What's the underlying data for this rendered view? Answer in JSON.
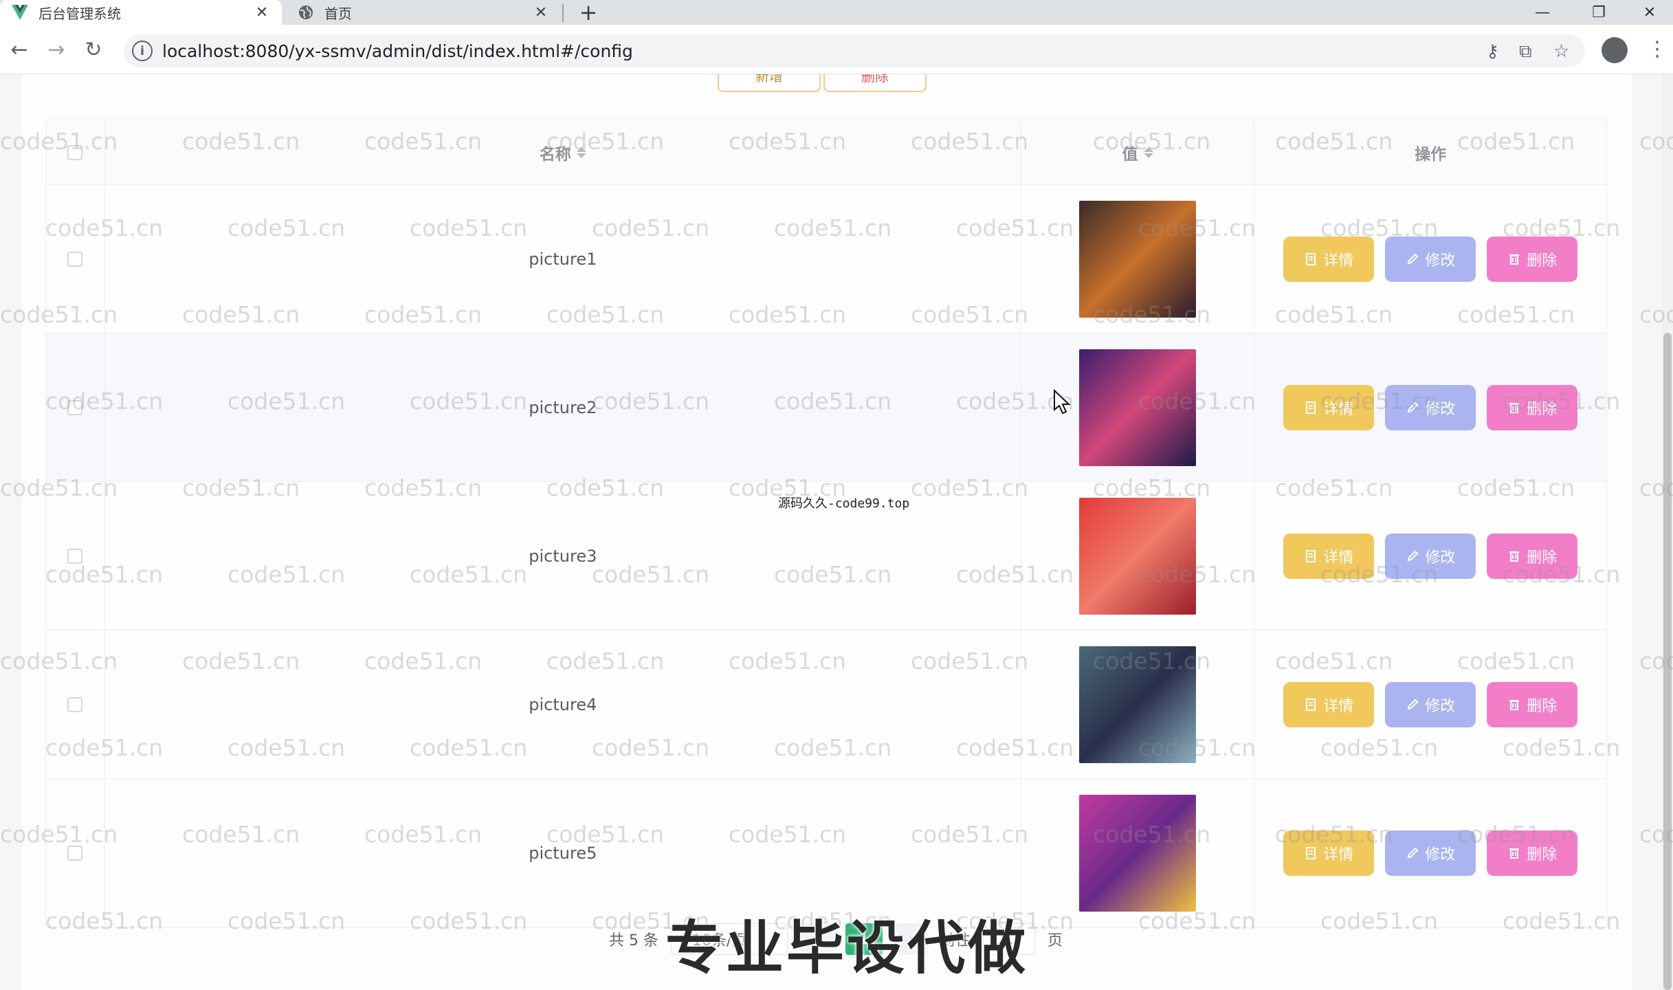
{
  "browser": {
    "tabs": [
      {
        "title": "后台管理系统",
        "active": true,
        "icon": "vue-logo-icon"
      },
      {
        "title": "首页",
        "active": false,
        "icon": "globe-icon"
      }
    ],
    "new_tab": "+",
    "url": "localhost:8080/yx-ssmv/admin/dist/index.html#/config"
  },
  "toolbar_buttons": {
    "add": "新增",
    "delete": "删除"
  },
  "table": {
    "columns": {
      "name": "名称",
      "value": "值",
      "ops": "操作"
    },
    "rows": [
      {
        "name": "picture1",
        "thumb_colors": [
          "#3a2a2a",
          "#c7702b",
          "#2a1c2e"
        ]
      },
      {
        "name": "picture2",
        "thumb_colors": [
          "#3a1f6e",
          "#d2477a",
          "#1c1a4a"
        ]
      },
      {
        "name": "picture3",
        "thumb_colors": [
          "#e23a3a",
          "#f07a6a",
          "#9a1f2a"
        ]
      },
      {
        "name": "picture4",
        "thumb_colors": [
          "#4a6a7a",
          "#2a2e4a",
          "#8ab0c0"
        ]
      },
      {
        "name": "picture5",
        "thumb_colors": [
          "#c23aa0",
          "#6a2a8a",
          "#f0c040"
        ]
      }
    ],
    "actions": {
      "detail": "详情",
      "edit": "修改",
      "delete": "删除"
    }
  },
  "pagination": {
    "total": "共 5 条",
    "page_size": "10条/页",
    "current_page": "1",
    "goto_prefix": "前往",
    "goto_value": "1",
    "goto_suffix": "页"
  },
  "overlay": {
    "watermark_text": "code51.cn",
    "center_note": "源码久久-code99.top",
    "promo_text": "专业毕设代做"
  },
  "colors": {
    "detail_button": "#f0c85c",
    "edit_button": "#a9b4f0",
    "delete_button": "#f27ec8",
    "pager_active": "#2bb673"
  }
}
